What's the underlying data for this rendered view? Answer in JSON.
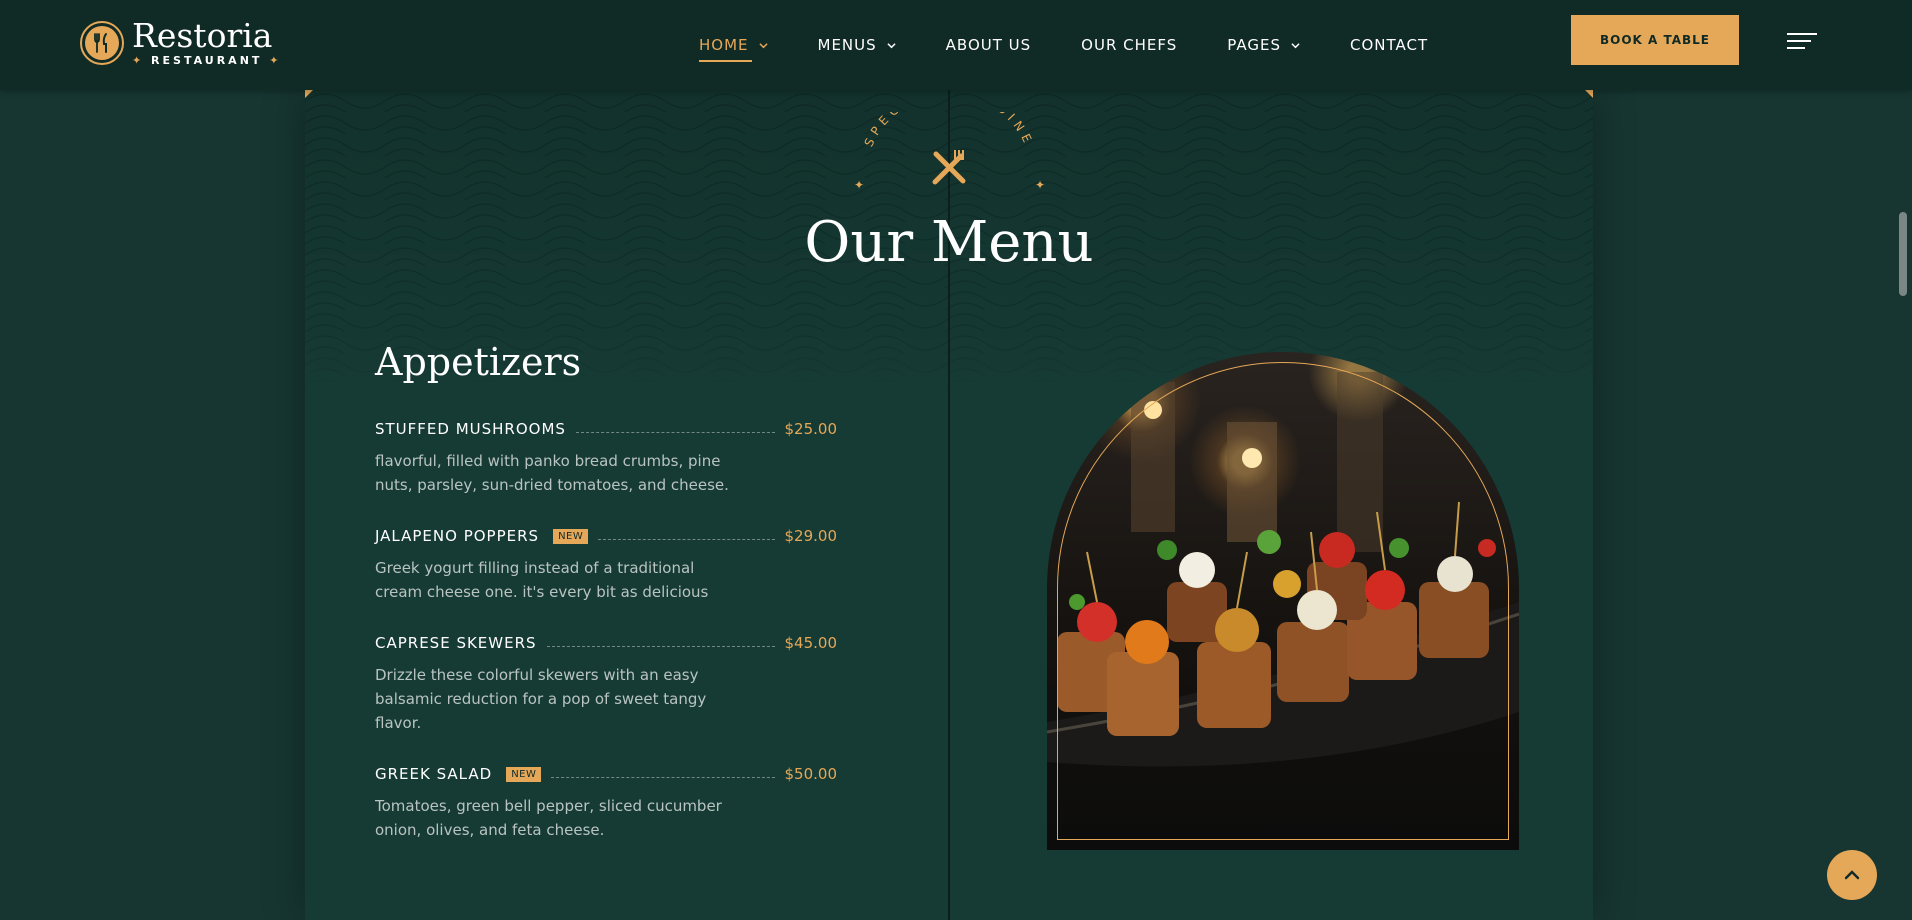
{
  "header": {
    "logo_name": "Restoria",
    "logo_sub": "RESTAURANT",
    "nav": [
      {
        "label": "HOME",
        "active": true,
        "dropdown": true
      },
      {
        "label": "MENUS",
        "active": false,
        "dropdown": true
      },
      {
        "label": "ABOUT US",
        "active": false,
        "dropdown": false
      },
      {
        "label": "OUR CHEFS",
        "active": false,
        "dropdown": false
      },
      {
        "label": "PAGES",
        "active": false,
        "dropdown": true
      },
      {
        "label": "CONTACT",
        "active": false,
        "dropdown": false
      }
    ],
    "book_label": "BOOK A TABLE"
  },
  "hero": {
    "emblem_text": "SPECIAL FINE DINE",
    "title": "Our Menu"
  },
  "menu": {
    "section": "Appetizers",
    "items": [
      {
        "name": "STUFFED MUSHROOMS",
        "badge": "",
        "price": "$25.00",
        "desc": "flavorful, filled with panko bread crumbs, pine nuts, parsley, sun-dried tomatoes, and cheese."
      },
      {
        "name": "JALAPENO POPPERS",
        "badge": "NEW",
        "price": "$29.00",
        "desc": "Greek yogurt filling instead of a traditional cream cheese one. it's every bit as delicious"
      },
      {
        "name": "CAPRESE SKEWERS",
        "badge": "",
        "price": "$45.00",
        "desc": "Drizzle these colorful skewers with an easy balsamic reduction for a pop of sweet tangy flavor."
      },
      {
        "name": "GREEK SALAD",
        "badge": "NEW",
        "price": "$50.00",
        "desc": "Tomatoes, green bell pepper, sliced cucumber onion, olives, and feta cheese."
      }
    ]
  },
  "theme": {
    "accent": "#e5a858",
    "header_bg": "#102a26",
    "page_bg": "#173631",
    "card_bg": "#163a34"
  },
  "icons": {
    "logo": "fork-knife-icon",
    "emblem": "crossed-fork-knife-icon",
    "menu": "hamburger-icon",
    "to_top": "chevron-up-icon"
  }
}
